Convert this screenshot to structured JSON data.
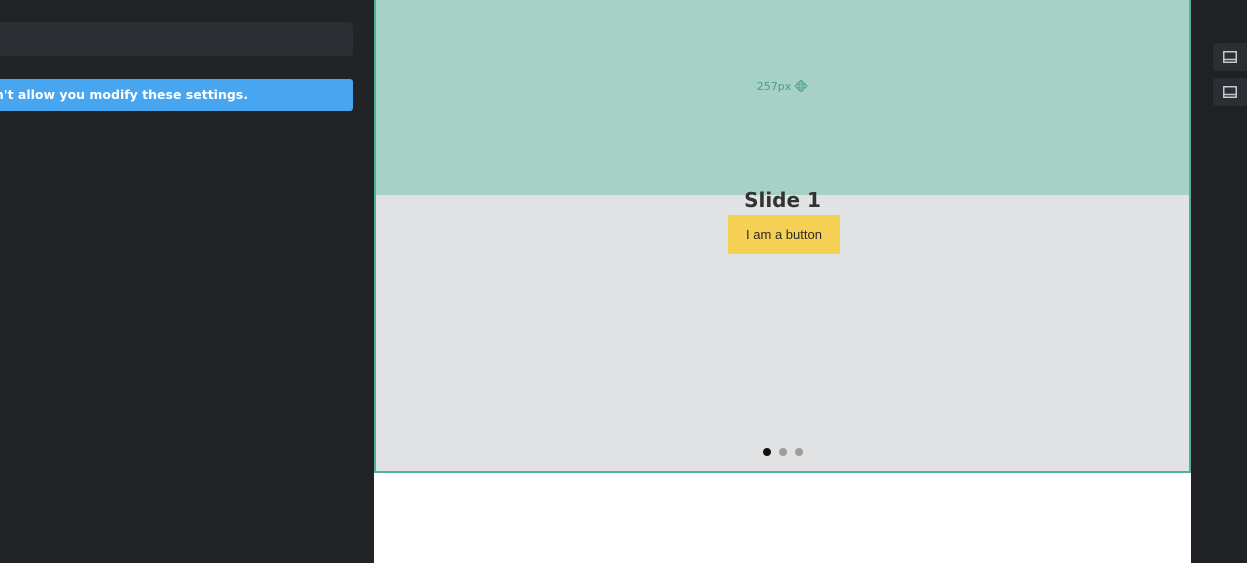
{
  "sidebar": {
    "notice": "Your current plan / panel doesn't allow you modify these settings."
  },
  "preview": {
    "padding_label": "257px",
    "slide_title": "Slide 1",
    "slide_button": "I am a button",
    "dots": 3,
    "active_dot": 0
  },
  "rail": {
    "buttons": [
      {
        "icon": "section-layout-icon"
      },
      {
        "icon": "section-layout-icon"
      }
    ]
  },
  "colors": {
    "accent": "#52b09a",
    "notice_bg": "#48a5f0",
    "button_bg": "#f6cf55",
    "padding_overlay": "#a7d0c7"
  }
}
